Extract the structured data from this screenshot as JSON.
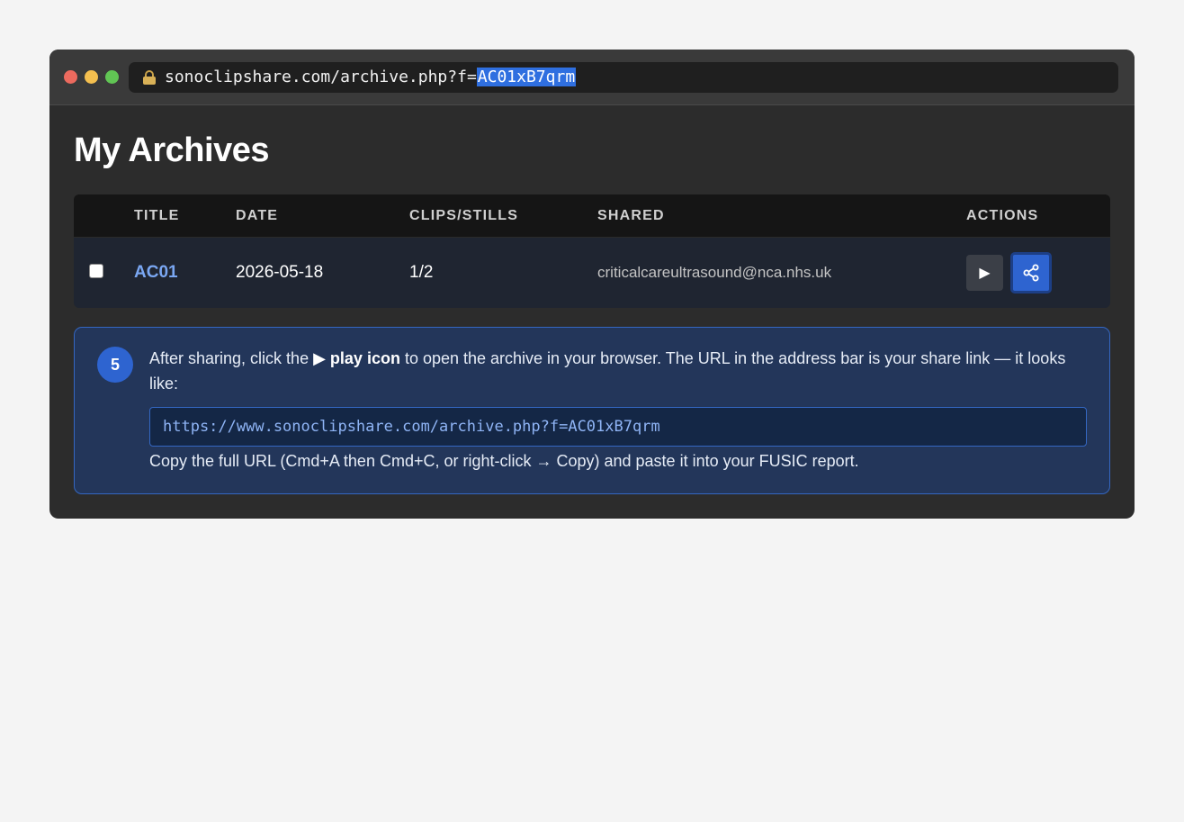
{
  "browser": {
    "url_prefix": "sonoclipshare.com/archive.php?f=",
    "url_selected": "AC01xB7qrm",
    "lock_icon": "lock-icon"
  },
  "page": {
    "title": "My Archives"
  },
  "table": {
    "headers": {
      "title": "TITLE",
      "date": "DATE",
      "clips": "CLIPS/STILLS",
      "shared": "SHARED",
      "actions": "ACTIONS"
    },
    "rows": [
      {
        "title": "AC01",
        "date": "2026-05-18",
        "clips": "1/2",
        "shared": "criticalcareultrasound@nca.nhs.uk",
        "play_glyph": "▶",
        "play_icon": "play-icon",
        "share_icon": "share-icon"
      }
    ]
  },
  "callout": {
    "step": "5",
    "text_before": "After sharing, click the ",
    "text_bold": "▶ play icon",
    "text_after": " to open the archive in your browser. The URL in the address bar is your share link — it looks like:",
    "url_example": "https://www.sonoclipshare.com/archive.php?f=AC01xB7qrm",
    "footer": "Copy the full URL (Cmd+A then Cmd+C, or right-click → Copy) and paste it into your FUSIC report."
  },
  "colors": {
    "accent": "#2e64d0",
    "link": "#7aa7f2",
    "url_highlight": "#2f6fe0"
  }
}
